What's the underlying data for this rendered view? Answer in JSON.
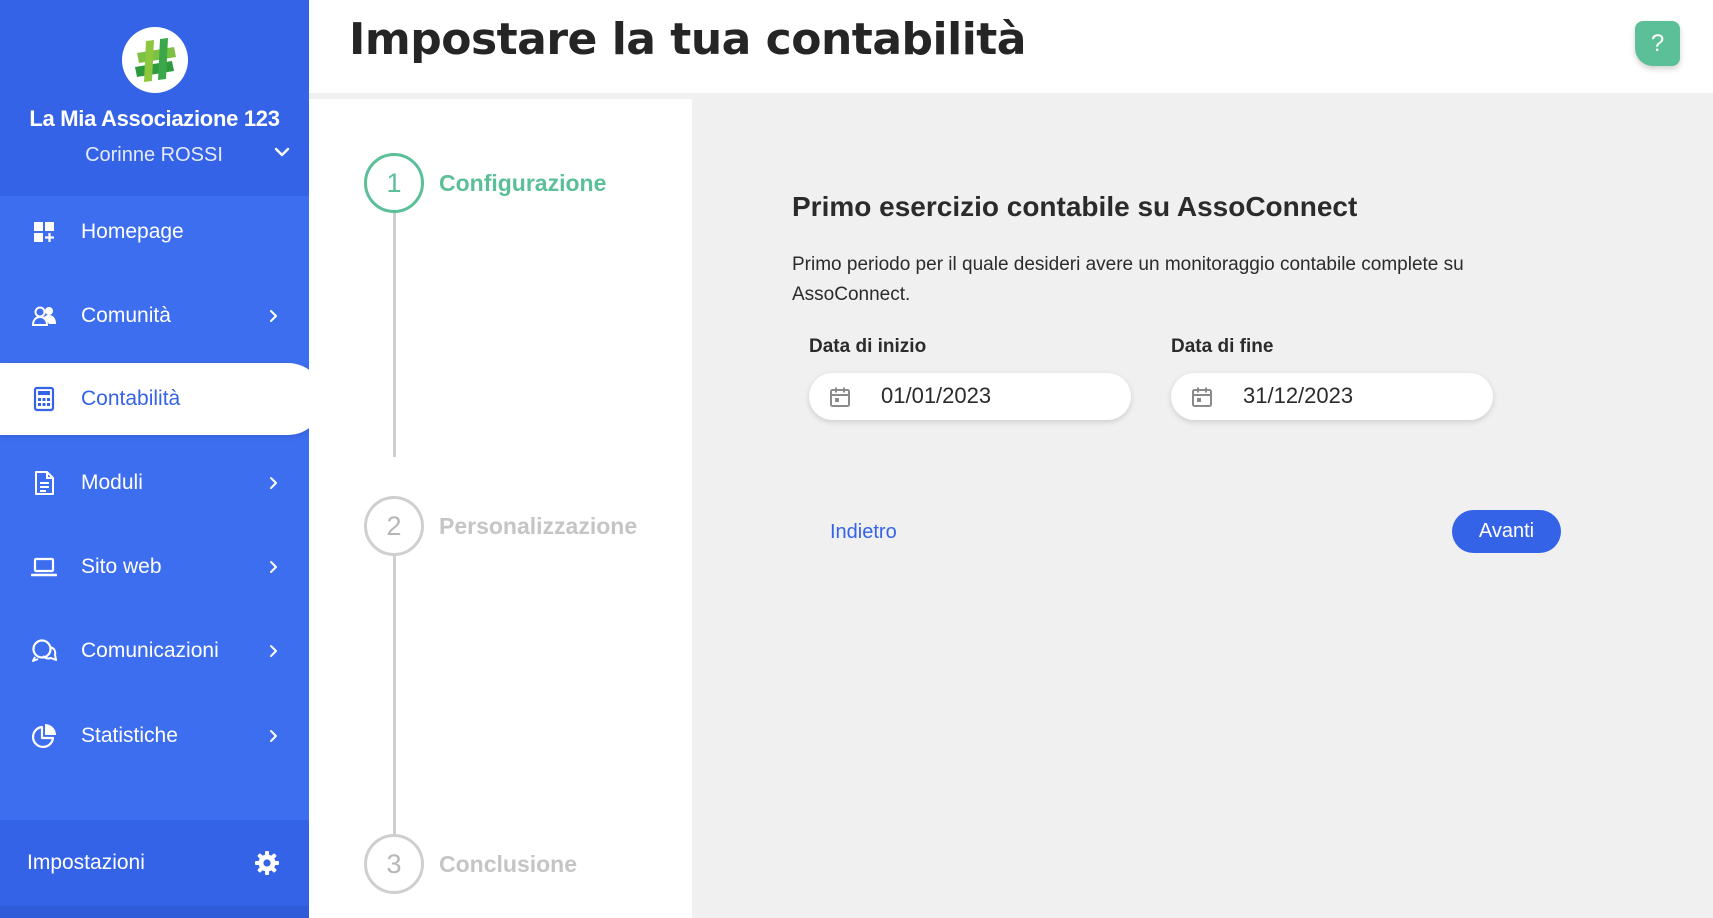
{
  "sidebar": {
    "org_name": "La Mia Associazione 123",
    "user_name": "Corinne ROSSI",
    "items": [
      {
        "label": "Homepage",
        "icon": "dashboard-icon",
        "has_submenu": false
      },
      {
        "label": "Comunità",
        "icon": "community-icon",
        "has_submenu": true
      },
      {
        "label": "Contabilità",
        "icon": "calculator-icon",
        "has_submenu": false,
        "active": true
      },
      {
        "label": "Moduli",
        "icon": "document-icon",
        "has_submenu": true
      },
      {
        "label": "Sito web",
        "icon": "laptop-icon",
        "has_submenu": true
      },
      {
        "label": "Comunicazioni",
        "icon": "chat-icon",
        "has_submenu": true
      },
      {
        "label": "Statistiche",
        "icon": "pie-chart-icon",
        "has_submenu": true
      }
    ],
    "settings_label": "Impostazioni"
  },
  "header": {
    "title": "Impostare la tua contabilità",
    "help_label": "?"
  },
  "stepper": {
    "steps": [
      {
        "number": "1",
        "label": "Configurazione",
        "state": "active"
      },
      {
        "number": "2",
        "label": "Personalizzazione",
        "state": "inactive"
      },
      {
        "number": "3",
        "label": "Conclusione",
        "state": "inactive"
      }
    ]
  },
  "form": {
    "title": "Primo esercizio contabile su AssoConnect",
    "description": "Primo periodo per il quale desideri avere un monitoraggio contabile complete su AssoConnect.",
    "start_label": "Data di inizio",
    "start_value": "01/01/2023",
    "end_label": "Data di fine",
    "end_value": "31/12/2023",
    "back_label": "Indietro",
    "next_label": "Avanti"
  },
  "colors": {
    "primary": "#3563e8",
    "sidebar": "#3d6ef0",
    "accent_green": "#5bbf98",
    "inactive_gray": "#c5c5c5"
  }
}
